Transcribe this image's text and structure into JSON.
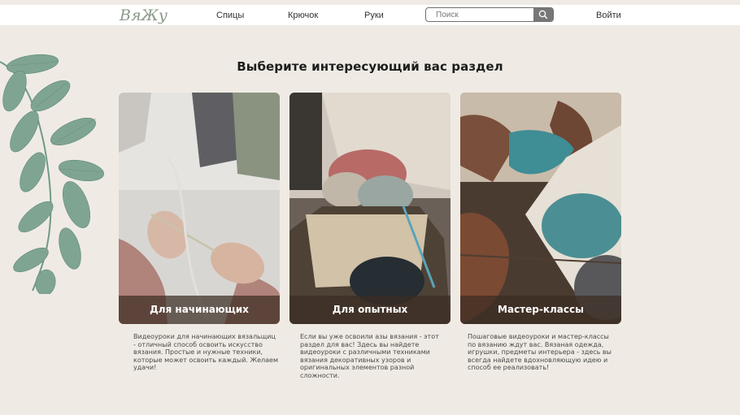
{
  "header": {
    "logo_text": "ВяЖу",
    "nav": [
      "Спицы",
      "Крючок",
      "Руки"
    ],
    "search_placeholder": "Поиск",
    "login_label": "Войти"
  },
  "main": {
    "title": "Выберите интересующий вас раздел",
    "cards": [
      {
        "label": "Для начинающих",
        "description": "Видеоуроки для начинающих вязальщиц - отличный способ освоить искусство вязания. Простые и нужные техники, которые может освоить каждый. Желаем удачи!"
      },
      {
        "label": "Для опытных",
        "description": "Если вы уже освоили азы вязания - этот раздел для вас! Здесь вы найдете видеоуроки с различными техниками вязания декоративных узоров и оригинальных элементов разной сложности."
      },
      {
        "label": "Мастер-классы",
        "description": "Пошаговые видеоуроки и мастер-классы по вязанию ждут вас. Вязаная одежда, игрушки, предметы интерьера - здесь вы всегда найдете вдохновляющую идею и способ ее реализовать!"
      }
    ]
  },
  "colors": {
    "background": "#efebe4",
    "leaf": "#6f9a84",
    "card_label_bar": "#3c2d23"
  }
}
